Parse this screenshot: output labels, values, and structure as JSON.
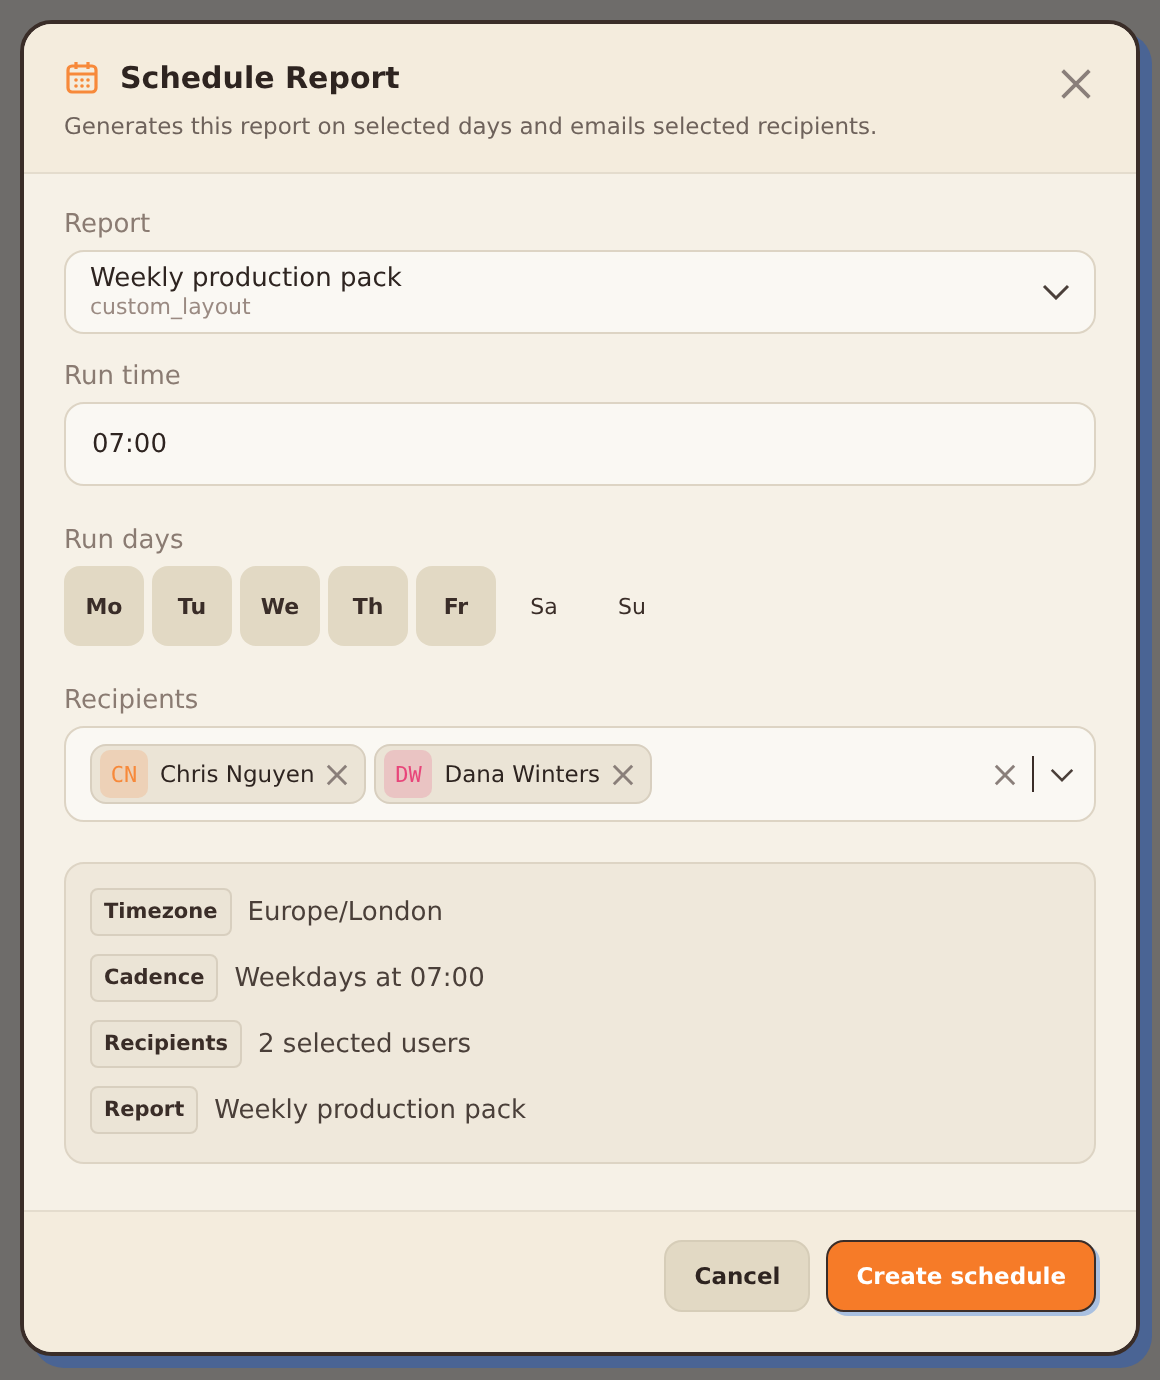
{
  "dialog": {
    "title": "Schedule Report",
    "subtitle": "Generates this report on selected days and emails selected recipients."
  },
  "report": {
    "label": "Report",
    "value": "Weekly production pack",
    "sub": "custom_layout"
  },
  "run_time": {
    "label": "Run time",
    "value": "07:00"
  },
  "run_days": {
    "label": "Run days",
    "days": [
      {
        "label": "Mo",
        "selected": true
      },
      {
        "label": "Tu",
        "selected": true
      },
      {
        "label": "We",
        "selected": true
      },
      {
        "label": "Th",
        "selected": true
      },
      {
        "label": "Fr",
        "selected": true
      },
      {
        "label": "Sa",
        "selected": false
      },
      {
        "label": "Su",
        "selected": false
      }
    ]
  },
  "recipients": {
    "label": "Recipients",
    "chips": [
      {
        "initials": "CN",
        "name": "Chris Nguyen",
        "color": "#f7893a"
      },
      {
        "initials": "DW",
        "name": "Dana Winters",
        "color": "#e8457a"
      }
    ]
  },
  "summary": [
    {
      "key": "Timezone",
      "value": "Europe/London"
    },
    {
      "key": "Cadence",
      "value": "Weekdays at 07:00"
    },
    {
      "key": "Recipients",
      "value": "2 selected users"
    },
    {
      "key": "Report",
      "value": "Weekly production pack"
    }
  ],
  "buttons": {
    "cancel": "Cancel",
    "primary": "Create schedule"
  }
}
